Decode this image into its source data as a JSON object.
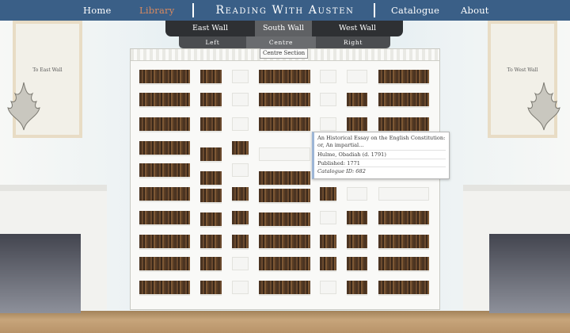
{
  "nav": {
    "left": [
      {
        "label": "Home"
      },
      {
        "label": "Library",
        "active": true
      }
    ],
    "title": "Reading With Austen",
    "right": [
      {
        "label": "Catalogue"
      },
      {
        "label": "About"
      }
    ]
  },
  "walls": [
    {
      "label": "East Wall"
    },
    {
      "label": "South Wall",
      "selected": true
    },
    {
      "label": "West Wall"
    }
  ],
  "sections": [
    {
      "label": "Left"
    },
    {
      "label": "Centre",
      "selected": true
    },
    {
      "label": "Right"
    }
  ],
  "section_tooltip": "Centre Section",
  "room": {
    "left_door_label": "To East Wall",
    "right_door_label": "To West Wall"
  },
  "book_tooltip": {
    "title": "An Historical Essay on the English Constitution: or, An impartial...",
    "author": "Hulme, Obadiah (d. 1791)",
    "published": "Published: 1771",
    "catalogue_id": "Catalogue ID: 682"
  },
  "colors": {
    "nav_bg": "#3a5f87",
    "active_link": "#d98a60",
    "subnav_bg": "#2e3033",
    "selected_tab": "#5f6164"
  }
}
